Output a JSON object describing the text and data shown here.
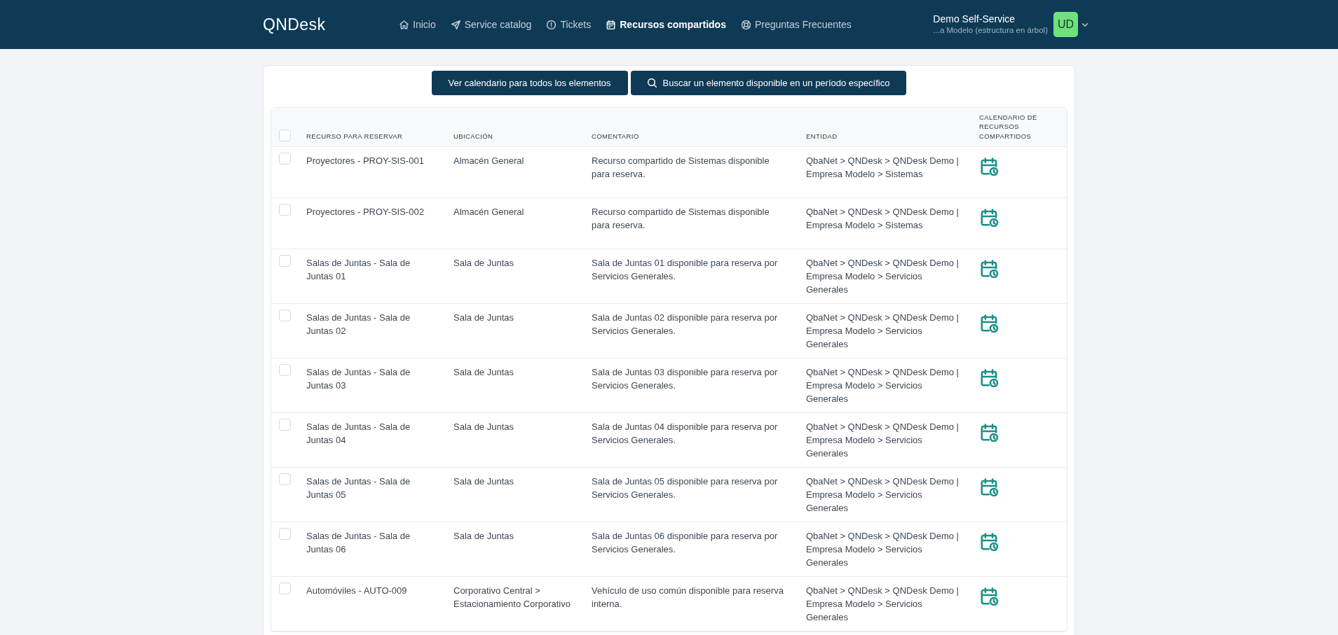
{
  "header": {
    "logo": "QNDesk",
    "nav": [
      {
        "label": "Inicio",
        "selected": false
      },
      {
        "label": "Service catalog",
        "selected": false
      },
      {
        "label": "Tickets",
        "selected": false
      },
      {
        "label": "Recursos compartidos",
        "selected": true
      },
      {
        "label": "Preguntas Frecuentes",
        "selected": false
      }
    ],
    "user": {
      "name": "Demo Self-Service",
      "entity": "...a Modelo (estructura en árbol)",
      "initials": "UD"
    }
  },
  "toolbar": {
    "buttons": [
      {
        "label": "Ver calendario para todos los elementos"
      },
      {
        "label": "Buscar un elemento disponible en un período específico"
      }
    ]
  },
  "table": {
    "select_all": {
      "checked": false
    },
    "columns": [
      "RECURSO PARA RESERVAR",
      "UBICACIÓN",
      "COMENTARIO",
      "ENTIDAD",
      "CALENDARIO DE RECURSOS COMPARTIDOS"
    ],
    "rows": [
      {
        "checked": false,
        "resource": "Proyectores - PROY-SIS-001",
        "location": "Almacén General",
        "comment": "Recurso compartido de Sistemas disponible para reserva.",
        "entity": "QbaNet > QNDesk > QNDesk Demo | Empresa Modelo > Sistemas"
      },
      {
        "checked": false,
        "resource": "Proyectores - PROY-SIS-002",
        "location": "Almacén General",
        "comment": "Recurso compartido de Sistemas disponible para reserva.",
        "entity": "QbaNet > QNDesk > QNDesk Demo | Empresa Modelo > Sistemas"
      },
      {
        "checked": false,
        "resource": "Salas de Juntas - Sala de Juntas 01",
        "location": "Sala de Juntas",
        "comment": "Sala de Juntas 01 disponible para reserva por Servicios Generales.",
        "entity": "QbaNet > QNDesk > QNDesk Demo | Empresa Modelo > Servicios Generales"
      },
      {
        "checked": false,
        "resource": "Salas de Juntas - Sala de Juntas 02",
        "location": "Sala de Juntas",
        "comment": "Sala de Juntas 02 disponible para reserva por Servicios Generales.",
        "entity": "QbaNet > QNDesk > QNDesk Demo | Empresa Modelo > Servicios Generales"
      },
      {
        "checked": false,
        "resource": "Salas de Juntas - Sala de Juntas 03",
        "location": "Sala de Juntas",
        "comment": "Sala de Juntas 03 disponible para reserva por Servicios Generales.",
        "entity": "QbaNet > QNDesk > QNDesk Demo | Empresa Modelo > Servicios Generales"
      },
      {
        "checked": false,
        "resource": "Salas de Juntas - Sala de Juntas 04",
        "location": "Sala de Juntas",
        "comment": "Sala de Juntas 04 disponible para reserva por Servicios Generales.",
        "entity": "QbaNet > QNDesk > QNDesk Demo | Empresa Modelo > Servicios Generales"
      },
      {
        "checked": false,
        "resource": "Salas de Juntas - Sala de Juntas 05",
        "location": "Sala de Juntas",
        "comment": "Sala de Juntas 05 disponible para reserva por Servicios Generales.",
        "entity": "QbaNet > QNDesk > QNDesk Demo | Empresa Modelo > Servicios Generales"
      },
      {
        "checked": false,
        "resource": "Salas de Juntas - Sala de Juntas 06",
        "location": "Sala de Juntas",
        "comment": "Sala de Juntas 06 disponible para reserva por Servicios Generales.",
        "entity": "QbaNet > QNDesk > QNDesk Demo | Empresa Modelo > Servicios Generales"
      },
      {
        "checked": false,
        "resource": "Automóviles - AUTO-009",
        "location": "Corporativo Central > Estacionamiento Corporativo",
        "comment": "Vehículo de uso común disponible para reserva interna.",
        "entity": "QbaNet > QNDesk > QNDesk Demo | Empresa Modelo > Servicios Generales"
      }
    ]
  }
}
